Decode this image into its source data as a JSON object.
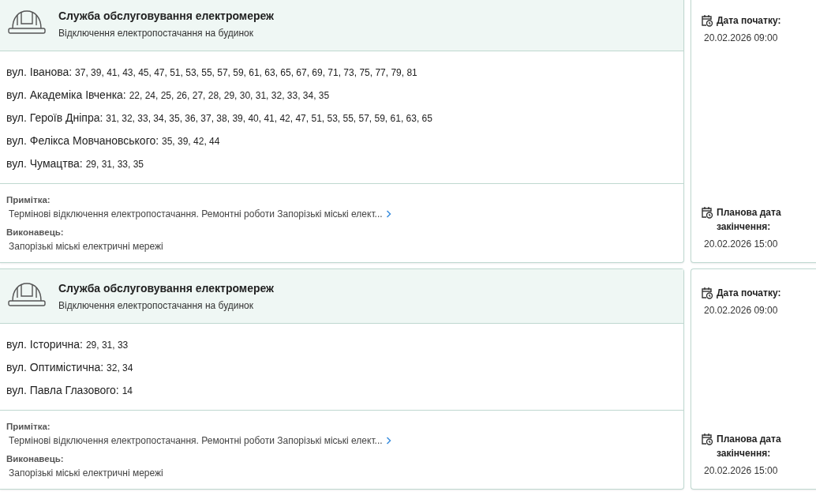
{
  "outages": [
    {
      "service": "Служба обслуговування електромереж",
      "type": "Відключення електропостачання на будинок",
      "addresses": [
        {
          "street": "вул. Іванова:",
          "houses": "37, 39, 41, 43, 45, 47, 51, 53, 55, 57, 59, 61, 63, 65, 67, 69, 71, 73, 75, 77, 79, 81"
        },
        {
          "street": "вул. Академіка Івченка:",
          "houses": "22, 24, 25, 26, 27, 28, 29, 30, 31, 32, 33, 34, 35"
        },
        {
          "street": "вул. Героїв Дніпра:",
          "houses": "31, 32, 33, 34, 35, 36, 37, 38, 39, 40, 41, 42, 47, 51, 53, 55, 57, 59, 61, 63, 65"
        },
        {
          "street": "вул. Фелікса Мовчановського:",
          "houses": "35, 39, 42, 44"
        },
        {
          "street": "вул. Чумацтва:",
          "houses": "29, 31, 33, 35"
        }
      ],
      "note_label": "Примітка:",
      "note": "Термінові відключення електропостачання. Ремонтні роботи Запорізькі міські елект...",
      "executor_label": "Виконавець:",
      "executor": "Запорізькі міські електричні мережі",
      "start_label": "Дата початку:",
      "start": "20.02.2026 09:00",
      "end_label": "Планова дата закінчення:",
      "end": "20.02.2026 15:00"
    },
    {
      "service": "Служба обслуговування електромереж",
      "type": "Відключення електропостачання на будинок",
      "addresses": [
        {
          "street": "вул. Історична:",
          "houses": "29, 31, 33"
        },
        {
          "street": "вул. Оптимістична:",
          "houses": "32, 34"
        },
        {
          "street": "вул. Павла Глазового:",
          "houses": "14"
        }
      ],
      "note_label": "Примітка:",
      "note": "Термінові відключення електропостачання. Ремонтні роботи Запорізькі міські елект...",
      "executor_label": "Виконавець:",
      "executor": "Запорізькі міські електричні мережі",
      "start_label": "Дата початку:",
      "start": "20.02.2026 09:00",
      "end_label": "Планова дата закінчення:",
      "end": "20.02.2026 15:00"
    }
  ]
}
